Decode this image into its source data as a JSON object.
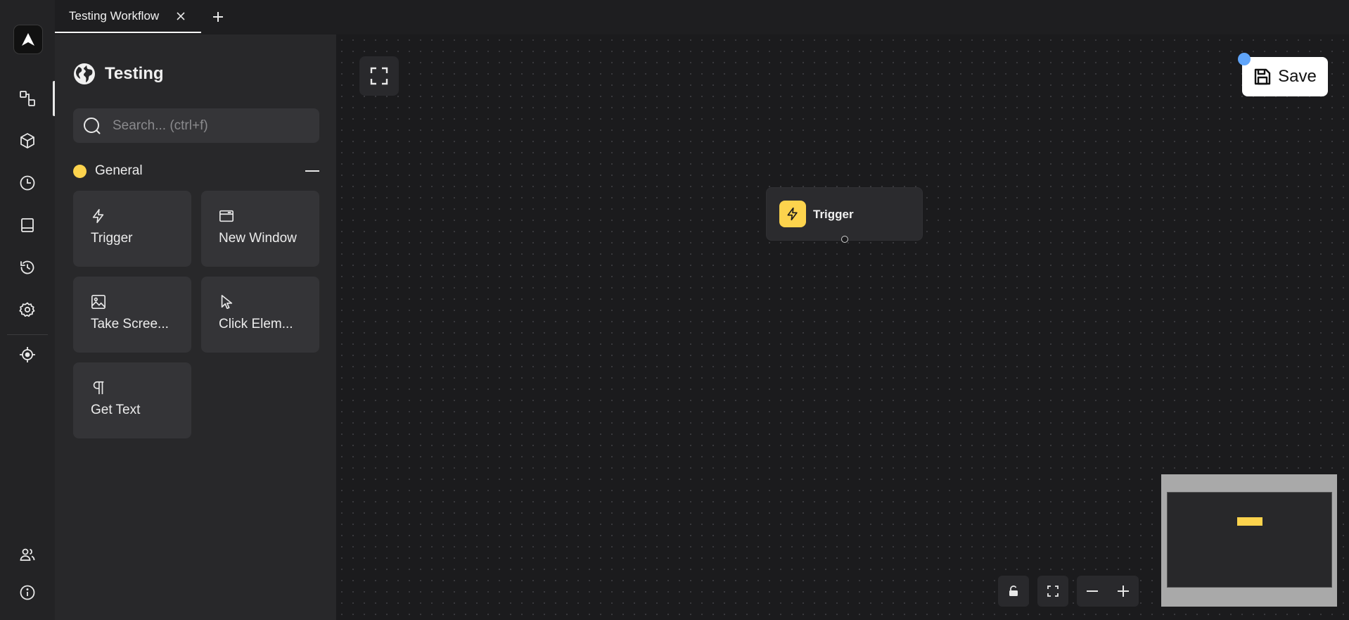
{
  "tabs": [
    {
      "label": "Testing Workflow",
      "active": true
    }
  ],
  "tabbar": {
    "close_icon": "close-icon",
    "add_icon": "plus-icon"
  },
  "rail": {
    "logo_icon": "automa-logo-icon",
    "items": [
      {
        "name": "workflows",
        "icon": "workflow-icon",
        "active": true
      },
      {
        "name": "packages",
        "icon": "cube-icon"
      },
      {
        "name": "schedule",
        "icon": "clock-icon"
      },
      {
        "name": "storage",
        "icon": "storage-icon"
      },
      {
        "name": "logs",
        "icon": "history-icon"
      },
      {
        "name": "settings",
        "icon": "gear-icon"
      },
      {
        "name": "element-selector",
        "icon": "focus-icon"
      }
    ],
    "bottom_items": [
      {
        "name": "team",
        "icon": "users-icon"
      },
      {
        "name": "about",
        "icon": "info-icon"
      }
    ]
  },
  "panel": {
    "title": "Testing",
    "title_icon": "globe-icon",
    "search_placeholder": "Search... (ctrl+f)",
    "category": {
      "label": "General",
      "color": "#fcd34d"
    },
    "blocks": [
      {
        "label": "Trigger",
        "icon": "lightning-icon"
      },
      {
        "label": "New Window",
        "icon": "window-icon"
      },
      {
        "label": "Take Scree...",
        "icon": "image-icon"
      },
      {
        "label": "Click Elem...",
        "icon": "cursor-icon"
      },
      {
        "label": "Get Text",
        "icon": "paragraph-icon"
      }
    ]
  },
  "canvas": {
    "save_label": "Save",
    "node": {
      "label": "Trigger",
      "icon": "lightning-icon",
      "color": "#fcd34d"
    },
    "controls": [
      "lock-icon",
      "fit-view-icon",
      "zoom-out-icon",
      "zoom-in-icon"
    ],
    "unsaved_indicator_color": "#60a5fa"
  },
  "colors": {
    "accent": "#fcd34d",
    "background": "#1b1b1d",
    "panel": "#28282a"
  }
}
